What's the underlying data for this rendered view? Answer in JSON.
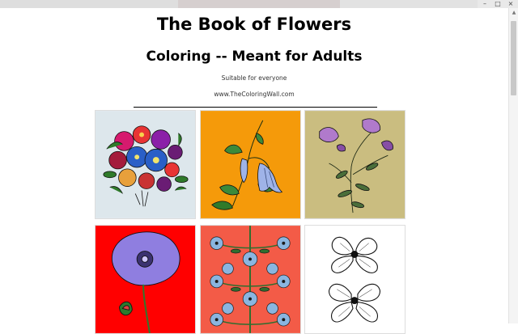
{
  "page": {
    "title": "The Book of Flowers",
    "subtitle": "Coloring -- Meant for Adults",
    "tagline": "Suitable for everyone",
    "website": "www.TheColoringWall.com"
  },
  "window_controls": {
    "minimize": "–",
    "maximize": "□",
    "close": "×"
  },
  "scrollbar": {
    "up_arrow": "▲"
  },
  "gallery": [
    {
      "name": "mixed-bouquet",
      "bg": "#dde7ec",
      "palette": [
        "#d61a6e",
        "#8b1fa8",
        "#2a5fc7",
        "#e83434",
        "#2f7a2a"
      ]
    },
    {
      "name": "bellflower",
      "bg": "#f59a0a",
      "palette": [
        "#9fb3e8",
        "#3c8a3a",
        "#1f5d1f"
      ]
    },
    {
      "name": "wild-rose-sprig",
      "bg": "#cabd80",
      "palette": [
        "#b07acb",
        "#874ea5",
        "#4a6e3a"
      ]
    },
    {
      "name": "poppy",
      "bg": "#ff0000",
      "palette": [
        "#8f7ee0",
        "#3b3270",
        "#2d7a2d",
        "#e24040"
      ]
    },
    {
      "name": "floral-pattern",
      "bg": "#f35b47",
      "palette": [
        "#8ab5e0",
        "#2f6e2f",
        "#1b1b1b"
      ]
    },
    {
      "name": "dogwood-line-art",
      "bg": "#ffffff",
      "palette": [
        "#111111",
        "#ffffff"
      ]
    }
  ]
}
